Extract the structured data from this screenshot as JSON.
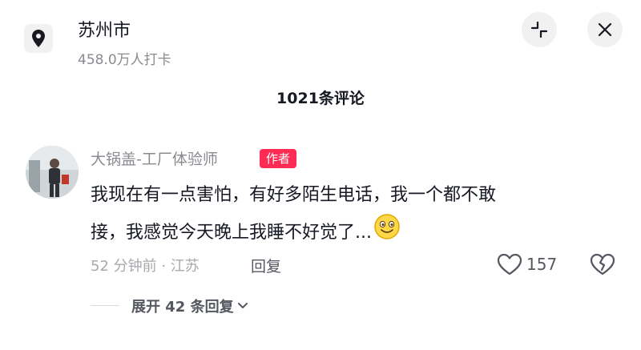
{
  "header": {
    "location_name": "苏州市",
    "checkins": "458.0万人打卡",
    "icons": [
      "location-pin-icon",
      "collapse-icon",
      "close-icon"
    ]
  },
  "comments_header": {
    "count_label": "1021条评论"
  },
  "comment": {
    "username": "大锅盖-工厂体验师",
    "badge": "作者",
    "text_line1": "我现在有一点害怕，有好多陌生电话，我一个都不敢",
    "text_line2": "接，我感觉今天晚上我睡不好觉了...",
    "meta": "52 分钟前 · 江苏",
    "reply_label": "回复",
    "like_count": "157"
  },
  "replies": {
    "expand_label": "展开 42 条回复"
  },
  "colors": {
    "badge_bg": "#fe2c55",
    "muted_text": "#8a8b91",
    "primary_text": "#161823"
  }
}
